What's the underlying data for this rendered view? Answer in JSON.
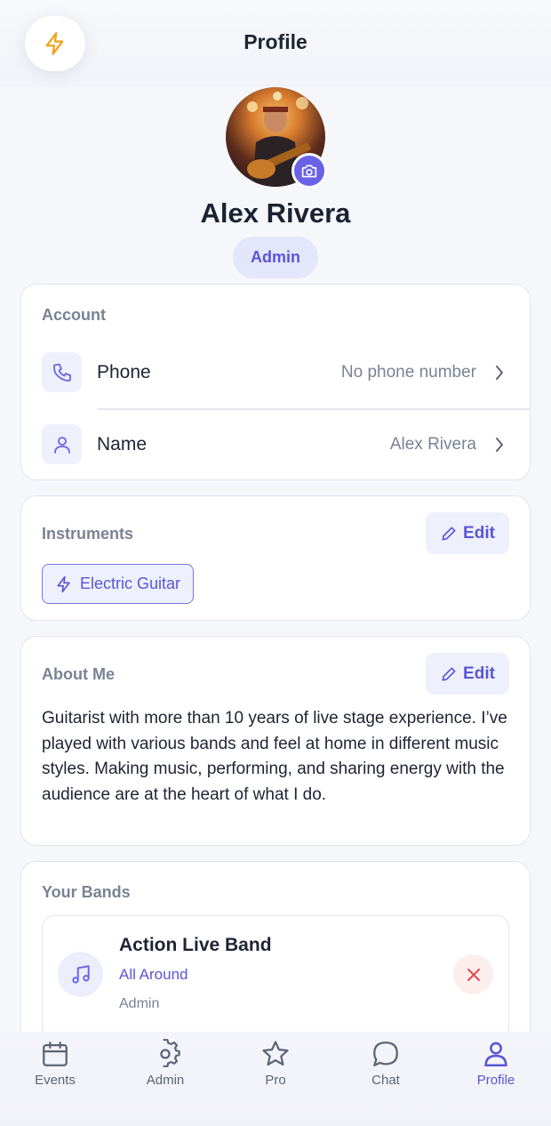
{
  "header": {
    "title": "Profile",
    "flash_icon": "lightning-icon"
  },
  "profile": {
    "name": "Alex Rivera",
    "role": "Admin",
    "avatar_icon": "camera-icon"
  },
  "account": {
    "label": "Account",
    "rows": [
      {
        "label": "Phone",
        "value": "No phone number",
        "icon": "phone-icon"
      },
      {
        "label": "Name",
        "value": "Alex Rivera",
        "icon": "user-icon"
      }
    ]
  },
  "instruments": {
    "label": "Instruments",
    "edit_label": "Edit",
    "items": [
      {
        "label": "Electric Guitar",
        "icon": "lightning-icon"
      }
    ]
  },
  "about": {
    "label": "About Me",
    "edit_label": "Edit",
    "text": "Guitarist with more than 10 years of live stage experience. I’ve played with various bands and feel at home in different music styles. Making music, performing, and sharing energy with the audience are at the heart of what I do."
  },
  "bands": {
    "label": "Your Bands",
    "items": [
      {
        "name": "Action Live Band",
        "genre": "All Around",
        "role": "Admin",
        "icon": "music-note-icon"
      }
    ]
  },
  "tabbar": {
    "active": "Profile",
    "items": [
      {
        "label": "Events",
        "icon": "calendar-icon"
      },
      {
        "label": "Admin",
        "icon": "gear-icon"
      },
      {
        "label": "Pro",
        "icon": "star-icon"
      },
      {
        "label": "Chat",
        "icon": "chat-bubble-icon"
      },
      {
        "label": "Profile",
        "icon": "user-icon"
      }
    ]
  },
  "colors": {
    "accent": "#5b55d6",
    "accent_bg": "#eef0fb",
    "flash": "#f0a51f",
    "danger": "#e5484d"
  }
}
